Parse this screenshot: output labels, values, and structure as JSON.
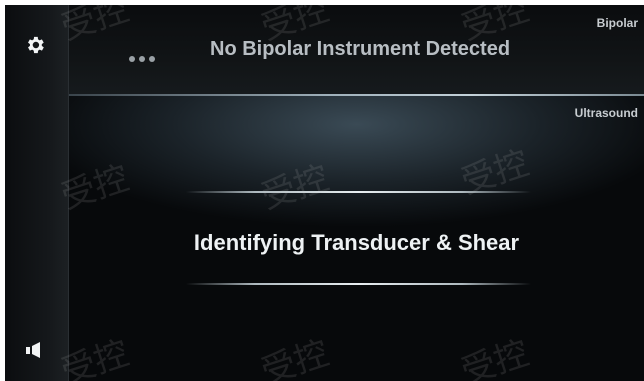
{
  "sidebar": {
    "settings_icon": "gear-icon",
    "home_icon": "home-icon"
  },
  "bipolar": {
    "tag": "Bipolar",
    "status": "No Bipolar Instrument Detected"
  },
  "ultrasound": {
    "tag": "Ultrasound",
    "status": "Identifying Transducer & Shear"
  },
  "watermark": "受控",
  "colors": {
    "background": "#050607",
    "text_primary": "#eef2f4",
    "text_secondary": "#b8bec3",
    "accent_line": "#c4d2d9"
  }
}
